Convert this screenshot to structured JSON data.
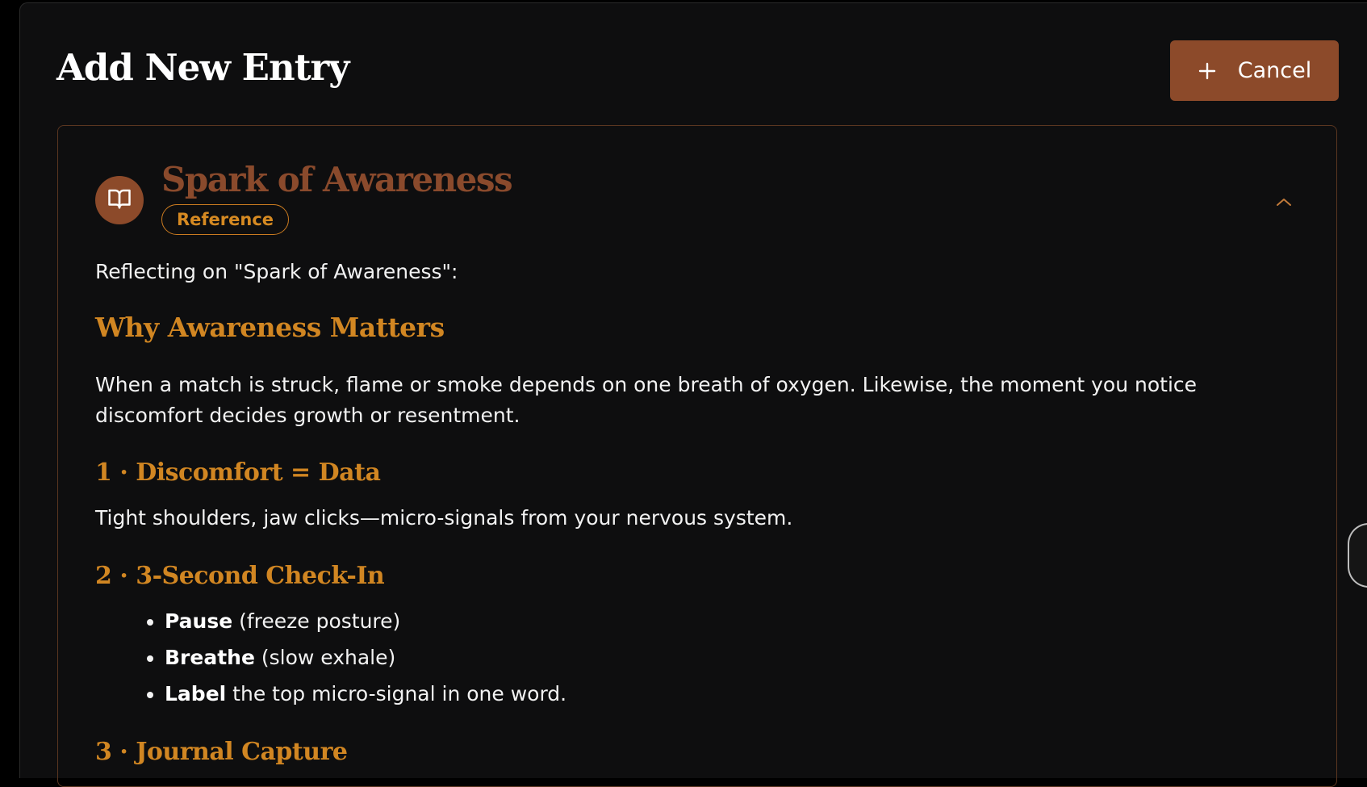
{
  "header": {
    "title": "Add New Entry",
    "cancel_label": "Cancel"
  },
  "entry": {
    "icon": "book-open-icon",
    "title": "Spark of Awareness",
    "badge": "Reference",
    "intro": "Reflecting on \"Spark of Awareness\":",
    "sections": {
      "why_heading": "Why Awareness Matters",
      "why_text": "When a match is struck, flame or smoke depends on one breath of oxygen. Likewise, the moment you notice discomfort decides growth or resentment.",
      "s1_heading": "1 · Discomfort = Data",
      "s1_text": "Tight shoulders, jaw clicks—micro-signals from your nervous system.",
      "s2_heading": "2 · 3-Second Check-In",
      "s2_items": [
        {
          "bold": "Pause",
          "rest": " (freeze posture)"
        },
        {
          "bold": "Breathe",
          "rest": " (slow exhale)"
        },
        {
          "bold": "Label",
          "rest": " the top micro-signal in one word."
        }
      ],
      "s3_heading": "3 · Journal Capture"
    }
  },
  "colors": {
    "accent": "#8c4a2a",
    "heading": "#d18622",
    "background": "#0e0e0f",
    "text": "#f2f2f2"
  }
}
